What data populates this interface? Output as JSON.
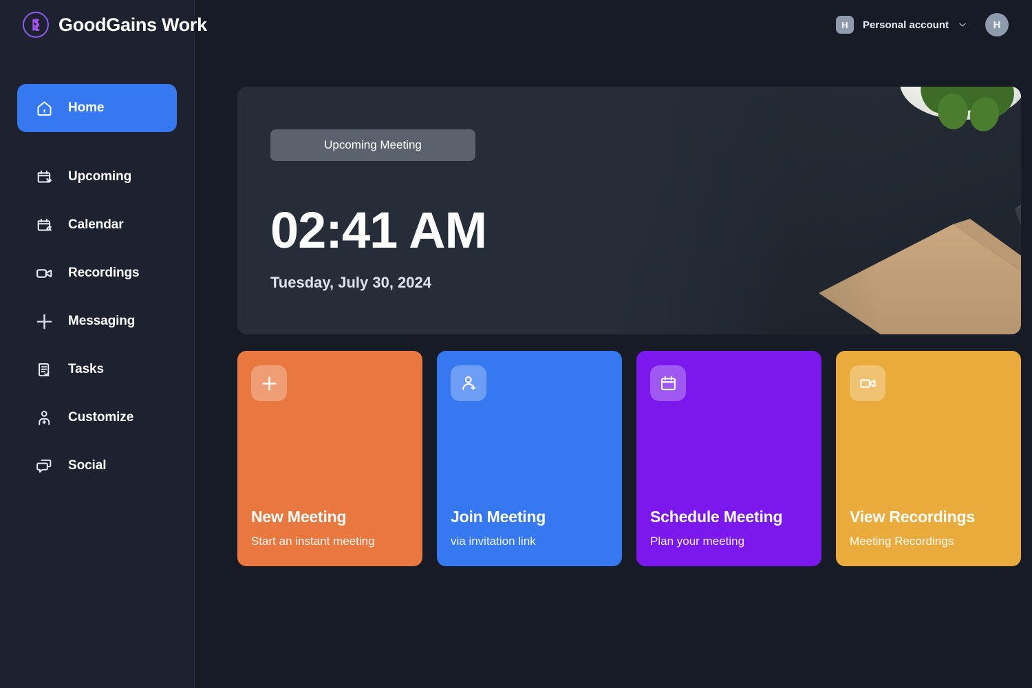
{
  "app": {
    "brand_name": "GoodGains Work",
    "logo_mark_text": "SG",
    "accent_blue": "#3578f0",
    "logo_purple": "#8b5cf6",
    "background": "#171b26",
    "sidebar_background": "#1d2130"
  },
  "header": {
    "account": {
      "avatar_initial": "H",
      "label": "Personal account",
      "chevron": "chevron-down-icon"
    },
    "user": {
      "avatar_initial": "H"
    }
  },
  "sidebar": {
    "items": [
      {
        "label": "Home",
        "icon": "home-icon",
        "active": true
      },
      {
        "label": "Upcoming",
        "icon": "calendar-forward-icon",
        "active": false
      },
      {
        "label": "Calendar",
        "icon": "calendar-back-icon",
        "active": false
      },
      {
        "label": "Recordings",
        "icon": "video-camera-icon",
        "active": false
      },
      {
        "label": "Messaging",
        "icon": "plus-icon",
        "active": false
      },
      {
        "label": "Tasks",
        "icon": "clipboard-check-icon",
        "active": false
      },
      {
        "label": "Customize",
        "icon": "user-plus-icon",
        "active": false
      },
      {
        "label": "Social",
        "icon": "chat-bubbles-icon",
        "active": false
      }
    ]
  },
  "hero": {
    "badge": "Upcoming Meeting",
    "time": "02:41 AM",
    "date": "Tuesday, July 30, 2024"
  },
  "cards": [
    {
      "title": "New Meeting",
      "subtitle": "Start an instant meeting",
      "icon": "plus-icon",
      "color": "#e8783f"
    },
    {
      "title": "Join Meeting",
      "subtitle": "via invitation link",
      "icon": "user-plus-icon",
      "color": "#3578f0"
    },
    {
      "title": "Schedule Meeting",
      "subtitle": "Plan your meeting",
      "icon": "calendar-icon",
      "color": "#7a18ee"
    },
    {
      "title": "View Recordings",
      "subtitle": "Meeting Recordings",
      "icon": "video-camera-icon",
      "color": "#e9ac3c"
    }
  ]
}
